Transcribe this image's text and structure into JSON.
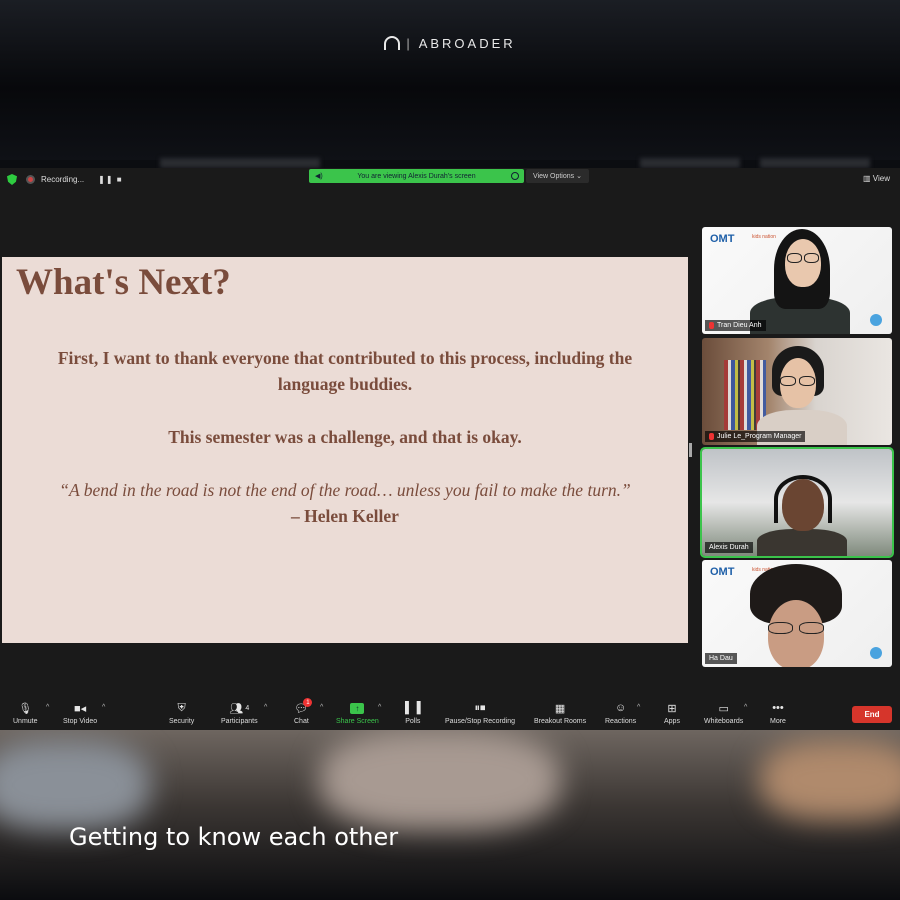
{
  "brand": {
    "name": "ABROADER"
  },
  "zoom": {
    "recording_label": "Recording...",
    "recording_controls": "❚❚ ■",
    "viewing_banner": "You are viewing Alexis Durah's screen",
    "view_options_label": "View Options ⌄",
    "view_label": "View"
  },
  "slide": {
    "title": "What's Next?",
    "paragraph1_line1": "First, I want to thank everyone that contributed to this process, including the",
    "paragraph1_line2": "language buddies.",
    "paragraph2": "This semester was a challenge, and that is okay.",
    "quote": "“A bend in the road is not the end of the road… unless you fail to make the turn.”",
    "author": "– Helen Keller"
  },
  "participants": [
    {
      "name": "Tran Dieu Anh",
      "muted": true,
      "logo": "OMT",
      "logo_sub": "kids nation"
    },
    {
      "name": "Julie Le_Program Manager",
      "muted": true
    },
    {
      "name": "Alexis Durah",
      "muted": false,
      "active_speaker": true
    },
    {
      "name": "Ha Dau",
      "muted": false,
      "logo": "OMT",
      "logo_sub": "kids nation"
    }
  ],
  "toolbar": {
    "unmute": "Unmute",
    "stop_video": "Stop Video",
    "security": "Security",
    "participants": "Participants",
    "participants_count": "4",
    "chat": "Chat",
    "chat_badge": "1",
    "share_screen": "Share Screen",
    "polls": "Polls",
    "pause_stop_recording": "Pause/Stop Recording",
    "breakout_rooms": "Breakout Rooms",
    "reactions": "Reactions",
    "apps": "Apps",
    "whiteboards": "Whiteboards",
    "more": "More",
    "end": "End"
  },
  "caption": "Getting to know each other",
  "colors": {
    "accent_green": "#3bc44b",
    "end_red": "#d6352b",
    "slide_bg": "#ebdcd6",
    "slide_text": "#7a4c3c"
  }
}
